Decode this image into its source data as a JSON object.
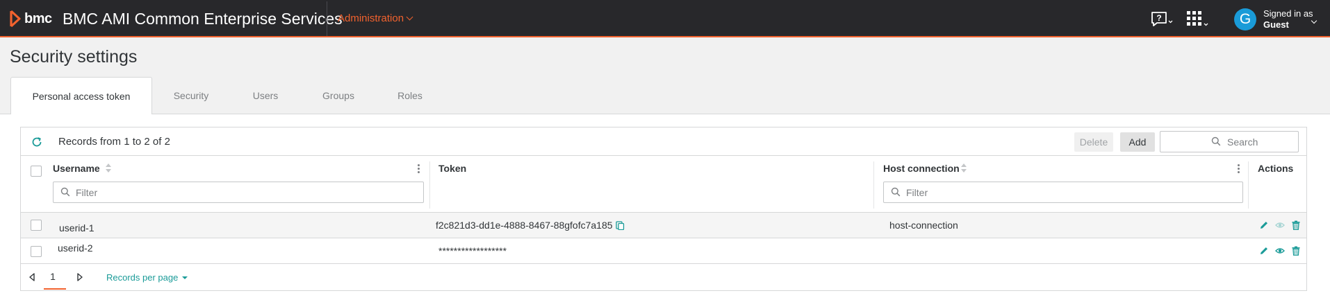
{
  "header": {
    "logo_text": "bmc",
    "app_title": "BMC AMI Common Enterprise Services",
    "admin_menu": "Administration",
    "help_icon": "help-icon",
    "apps_icon": "apps-grid-icon",
    "avatar_letter": "G",
    "signed_in_label": "Signed in as",
    "user_name": "Guest",
    "accent": "#f2622e"
  },
  "page": {
    "title": "Security settings"
  },
  "tabs": [
    {
      "label": "Personal access token",
      "active": true
    },
    {
      "label": "Security",
      "active": false
    },
    {
      "label": "Users",
      "active": false
    },
    {
      "label": "Groups",
      "active": false
    },
    {
      "label": "Roles",
      "active": false
    }
  ],
  "toolbar": {
    "records_text": "Records from 1 to 2 of 2",
    "delete_label": "Delete",
    "add_label": "Add",
    "search_placeholder": "Search"
  },
  "table": {
    "columns": {
      "username": "Username",
      "token": "Token",
      "host_connection": "Host connection",
      "actions": "Actions"
    },
    "filter_placeholder": "Filter",
    "rows": [
      {
        "username": "userid-1",
        "token": "f2c821d3-dd1e-4888-8467-88gfofc7a185",
        "host_connection": "host-connection"
      },
      {
        "username": "userid-2",
        "token": "******************",
        "host_connection": ""
      }
    ],
    "action_icons": [
      "edit-icon",
      "view-icon",
      "delete-icon"
    ]
  },
  "pager": {
    "current_page": "1",
    "records_per_page_label": "Records per page"
  }
}
